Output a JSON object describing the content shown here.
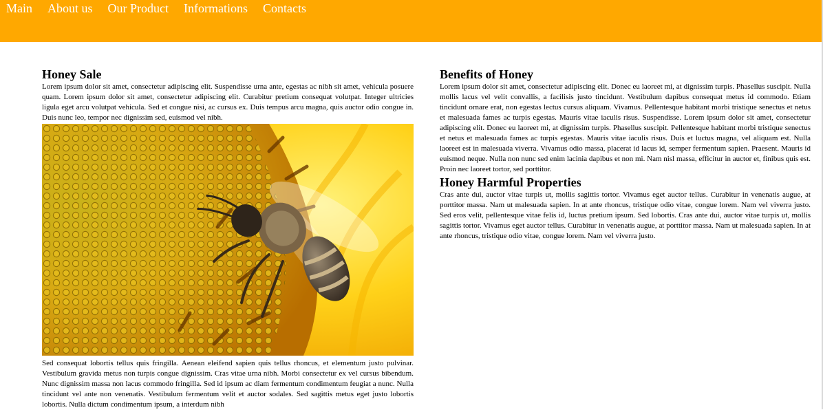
{
  "nav": {
    "items": [
      "Main",
      "About us",
      "Our Product",
      "Informations",
      "Contacts"
    ]
  },
  "colors": {
    "header_bg": "#ffa800",
    "nav_text": "#ffffff"
  },
  "left": {
    "title": "Honey Sale",
    "intro": "Lorem ipsum dolor sit amet, consectetur adipiscing elit. Suspendisse urna ante, egestas ac nibh sit amet, vehicula posuere quam. Lorem ipsum dolor sit amet, consectetur adipiscing elit. Curabitur pretium consequat volutpat. Integer ultricies ligula eget arcu volutpat vehicula. Sed et congue nisi, ac cursus ex. Duis tempus arcu magna, quis auctor odio congue in. Duis nunc leo, tempor nec dignissim sed, euismod vel nibh.",
    "image_icon": "bee-on-sunflower-photo",
    "body": "Sed consequat lobortis tellus quis fringilla. Aenean eleifend sapien quis tellus rhoncus, et elementum justo pulvinar. Vestibulum gravida metus non turpis congue dignissim. Cras vitae urna nibh. Morbi consectetur ex vel cursus bibendum. Nunc dignissim massa non lacus commodo fringilla. Sed id ipsum ac diam fermentum condimentum feugiat a nunc. Nulla tincidunt vel ante non venenatis. Vestibulum fermentum velit et auctor sodales. Sed sagittis metus eget justo lobortis lobortis. Nulla dictum condimentum ipsum, a interdum nibh"
  },
  "right": {
    "benefits_title": "Benefits of Honey",
    "benefits_text": "Lorem ipsum dolor sit amet, consectetur adipiscing elit. Donec eu laoreet mi, at dignissim turpis. Phasellus suscipit. Nulla mollis lacus vel velit convallis, a facilisis justo tincidunt. Vestibulum dapibus consequat metus id commodo. Etiam tincidunt ornare erat, non egestas lectus cursus aliquam. Vivamus. Pellentesque habitant morbi tristique senectus et netus et malesuada fames ac turpis egestas. Mauris vitae iaculis risus. Suspendisse. Lorem ipsum dolor sit amet, consectetur adipiscing elit. Donec eu laoreet mi, at dignissim turpis. Phasellus suscipit. Pellentesque habitant morbi tristique senectus et netus et malesuada fames ac turpis egestas. Mauris vitae iaculis risus. Duis et luctus magna, vel aliquam est. Nulla laoreet est in malesuada viverra. Vivamus odio massa, placerat id lacus id, semper fermentum sapien. Praesent. Mauris id euismod neque. Nulla non nunc sed enim lacinia dapibus et non mi. Nam nisl massa, efficitur in auctor et, finibus quis est. Proin nec laoreet tortor, sed porttitor.",
    "harmful_title": "Honey Harmful Properties",
    "harmful_text": "Cras ante dui, auctor vitae turpis ut, mollis sagittis tortor. Vivamus eget auctor tellus. Curabitur in venenatis augue, at porttitor massa. Nam ut malesuada sapien. In at ante rhoncus, tristique odio vitae, congue lorem. Nam vel viverra justo. Sed eros velit, pellentesque vitae felis id, luctus pretium ipsum. Sed lobortis. Cras ante dui, auctor vitae turpis ut, mollis sagittis tortor. Vivamus eget auctor tellus. Curabitur in venenatis augue, at porttitor massa. Nam ut malesuada sapien. In at ante rhoncus, tristique odio vitae, congue lorem. Nam vel viverra justo."
  }
}
